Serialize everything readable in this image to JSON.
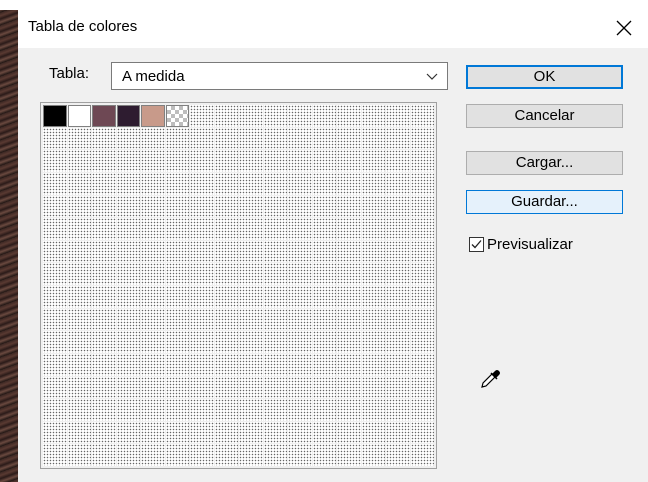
{
  "dialog": {
    "title": "Tabla de colores"
  },
  "table": {
    "label": "Tabla:",
    "selected": "A medida"
  },
  "swatches": {
    "colors": [
      "#000000",
      "#ffffff",
      "#6e4854",
      "#2e1c30",
      "#c89a8a",
      "transparent"
    ],
    "empty_cell_count": 250
  },
  "buttons": {
    "ok": "OK",
    "cancel": "Cancelar",
    "load": "Cargar...",
    "save": "Guardar..."
  },
  "preview": {
    "label": "Previsualizar",
    "checked": true
  },
  "icons": {
    "close": "close-icon",
    "dropdown": "chevron-down-icon",
    "eyedropper": "eyedropper-icon"
  },
  "colors": {
    "accent": "#0078d7",
    "background": "#f0f0f0"
  }
}
